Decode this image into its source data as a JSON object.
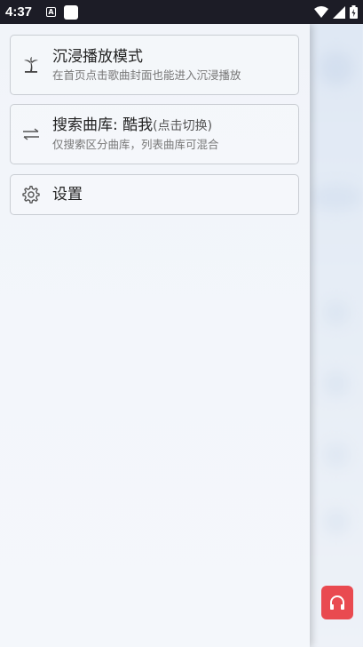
{
  "status_bar": {
    "time": "4:37",
    "left_icon_letter": "A"
  },
  "drawer": {
    "items": [
      {
        "title": "沉浸播放模式",
        "subtitle": "在首页点击歌曲封面也能进入沉浸播放",
        "icon": "palm-tree-icon"
      },
      {
        "title": "搜索曲库: 酷我",
        "title_suffix": "(点击切换)",
        "subtitle": "仅搜索区分曲库，列表曲库可混合",
        "icon": "swap-icon"
      },
      {
        "title": "设置",
        "icon": "gear-icon"
      }
    ]
  },
  "colors": {
    "status_bar_bg": "#1c1c26",
    "fab_bg": "#e94a50"
  }
}
